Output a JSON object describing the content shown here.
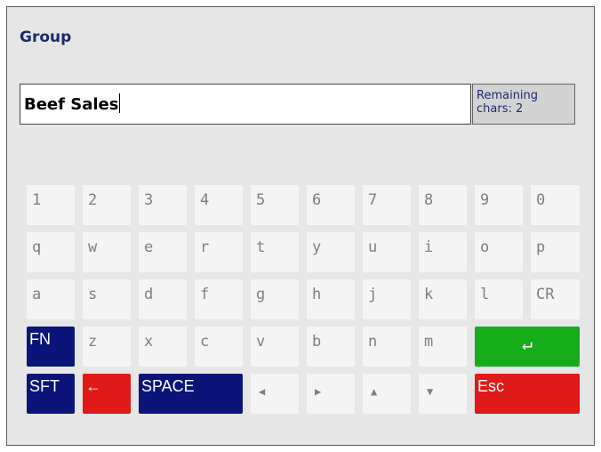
{
  "dialog": {
    "title": "Group",
    "input_value": "Beef Sales",
    "remaining": {
      "line1": "Remaining",
      "line2": "chars: 2"
    }
  },
  "keys": {
    "row1": [
      "1",
      "2",
      "3",
      "4",
      "5",
      "6",
      "7",
      "8",
      "9",
      "0"
    ],
    "row2": [
      "q",
      "w",
      "e",
      "r",
      "t",
      "y",
      "u",
      "i",
      "o",
      "p"
    ],
    "row3": [
      "a",
      "s",
      "d",
      "f",
      "g",
      "h",
      "j",
      "k",
      "l",
      "CR"
    ],
    "row4": [
      "FN",
      "z",
      "x",
      "c",
      "v",
      "b",
      "n",
      "m",
      "↵"
    ],
    "row5": [
      "SFT",
      "←",
      "SPACE",
      "◀",
      "▶",
      "▲",
      "▼",
      "Esc"
    ]
  },
  "colors": {
    "navy": "#0b1478",
    "red": "#e01919",
    "green": "#17ad1a",
    "key_face": "#f4f4f4",
    "panel": "#e6e6e6"
  }
}
